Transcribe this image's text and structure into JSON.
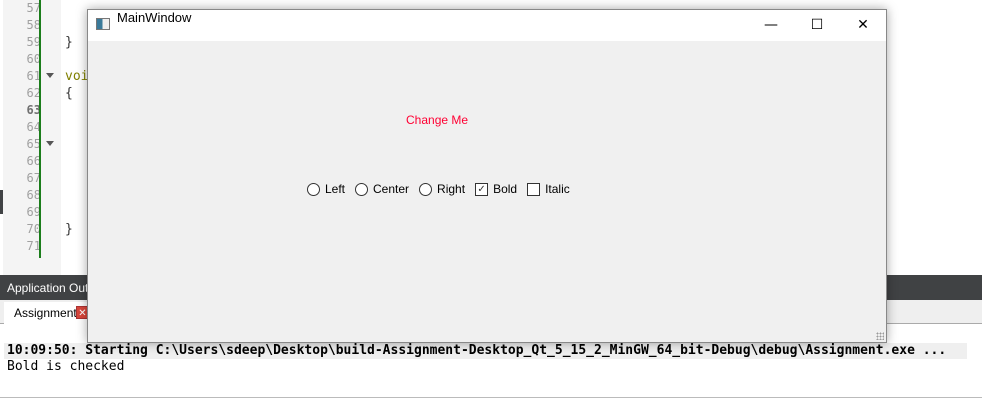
{
  "editor": {
    "line_numbers": [
      "57",
      "58",
      "59",
      "60",
      "61",
      "62",
      "63",
      "64",
      "65",
      "66",
      "67",
      "68",
      "69",
      "70",
      "71"
    ],
    "current_line": "63",
    "code": [
      {
        "line": "59",
        "text": "}"
      },
      {
        "line": "61",
        "text": "voi"
      },
      {
        "line": "62",
        "text": "{"
      },
      {
        "line": "70",
        "text": "}"
      }
    ]
  },
  "output_panel": {
    "title": "Application Outp",
    "tab": "Assignment",
    "tab_close": "✕",
    "lines": [
      "10:09:50: Starting C:\\Users\\sdeep\\Desktop\\build-Assignment-Desktop_Qt_5_15_2_MinGW_64_bit-Debug\\debug\\Assignment.exe ...",
      "Bold is checked"
    ]
  },
  "window": {
    "title": "MainWindow",
    "minimize": "—",
    "maximize": "☐",
    "close": "✕",
    "label": "Change Me",
    "label_color": "#ff0033",
    "radios": [
      {
        "label": "Left",
        "checked": false
      },
      {
        "label": "Center",
        "checked": false
      },
      {
        "label": "Right",
        "checked": false
      }
    ],
    "checkboxes": [
      {
        "label": "Bold",
        "checked": true
      },
      {
        "label": "Italic",
        "checked": false
      }
    ]
  }
}
